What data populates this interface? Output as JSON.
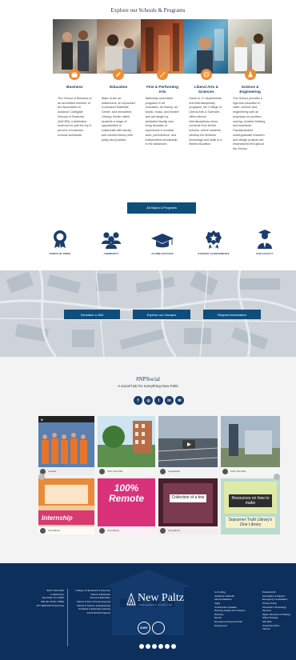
{
  "schools_section": {
    "title": "Explore our Schools & Programs",
    "schools": [
      {
        "icon": "briefcase-icon",
        "title": "Business",
        "desc": "The School of Business is an accredited member of the Association to Advance Collegiate Schools of Business (AACSB), a distinction reserved for just the top 5 percent of business schools worldwide."
      },
      {
        "icon": "pencil-icon",
        "title": "Education",
        "desc": "State-of-the art classrooms, an expanded Curriculum Materials Center, and remodeled Literacy Center offers students a range of opportunities to collaborate with faculty and connect theory with policy and practice."
      },
      {
        "icon": "paintbrush-icon",
        "title": "Fine & Performing Arts",
        "desc": "Nationally accredited programs in art education, art history, art studio, music, and theatre arts are taught by dedicated faculty who bring decades of experience in creative work, performance, and independent scholarship in the classroom."
      },
      {
        "icon": "globe-icon",
        "title": "Liberal Arts & Sciences",
        "desc": "Home to 17 departments and interdisciplinary programs, the College of Liberal Arts & Sciences offers vibrant interdisciplinary minor curricula from all five schools, where students develop the timeless knowledge and skills of a liberal education."
      },
      {
        "icon": "flask-icon",
        "title": "Science & Engineering",
        "desc": "The School provides a rigorous education in math, science and engineering with an emphasis on problem-solving, creative thinking and teamwork. Faculty/student undergraduate research and design projects are emphasized throughout the School."
      }
    ],
    "button": "All Majors & Programs"
  },
  "pride": [
    {
      "icon": "ribbon-icon",
      "label": "POINTS OF PRIDE"
    },
    {
      "icon": "people-icon",
      "label": "COMMUNITY"
    },
    {
      "icon": "graduation-cap-icon",
      "label": "ALUMNI SUCCESS"
    },
    {
      "icon": "star-badge-icon",
      "label": "STUDENT ACHIEVEMENTS"
    },
    {
      "icon": "professor-icon",
      "label": "OUR FACULTY"
    }
  ],
  "map_buttons": [
    "Schedule a Visit",
    "Explore our Campus",
    "Request Information"
  ],
  "social": {
    "hashtag": "#NPSocial",
    "subtitle": "A social hub for everything New Paltz",
    "icons": [
      "facebook-icon",
      "instagram-icon",
      "twitter-icon",
      "linkedin-icon",
      "email-icon"
    ],
    "icon_glyphs": [
      "f",
      "◎",
      "t",
      "in",
      "✉"
    ],
    "tiles": [
      {
        "name": "tile-1",
        "handle": "newpaltz",
        "color": "#3f5c8c"
      },
      {
        "name": "tile-2",
        "handle": "SUNY New Paltz",
        "color": "#6f9a6a"
      },
      {
        "name": "tile-3",
        "handle": "newpaltzweb",
        "color": "#4c5058"
      },
      {
        "name": "tile-4",
        "handle": "SUNY New Paltz",
        "color": "#8fa5b8"
      },
      {
        "name": "tile-5",
        "handle": "sunynplibrary",
        "overlay": "Internship",
        "color": "#f0a65a"
      },
      {
        "name": "tile-6",
        "handle": "sunynplibrary",
        "overlay": "100% Remote",
        "color": "#d9327a"
      },
      {
        "name": "tile-7",
        "handle": "sunynplibrary",
        "overlay": "Collection of a few",
        "color": "#6a2b3f"
      },
      {
        "name": "tile-8",
        "handle": "sunynplibrary",
        "overlay": "Resources on how to make",
        "color": "#9cc7b8"
      }
    ],
    "tile_caption": "Sojourner Truth Library's Zine Library"
  },
  "footer": {
    "address": [
      "SUNY New Paltz",
      "1 Hawk Drive",
      "New Paltz, NY 12561",
      "845-257-SUNY (7869)",
      "877-NEW-PALTZ (toll free)"
    ],
    "schools": [
      "College of Liberal Arts & Sciences",
      "School of Business",
      "School of Education",
      "School of Fine & Performing Arts",
      "School of Science & Engineering",
      "Graduate & Extended Learning",
      "International Programs"
    ],
    "logo_main": "New Paltz",
    "logo_sub": "STATE UNIVERSITY OF NEW YORK",
    "suny": "SUNY",
    "links_1": [
      "A-Z Listing",
      "Academic Calendar",
      "Alumni Relations",
      "Apply",
      "Construction Updates",
      "Diversity, Equity and Inclusion",
      "Directory",
      "Events",
      "Emergency Response Plan",
      "Employment"
    ],
    "links_2": [
      "Financial Aid",
      "Foundation & Support",
      "Emergency Consultation Privacy Policy",
      "Information Technology Services",
      "Maps, Directions & Parking",
      "Office Closings",
      "Site Map",
      "University Police",
      "Visit Us"
    ],
    "social_icons": [
      "facebook-icon",
      "instagram-icon",
      "twitter-icon",
      "youtube-icon",
      "linkedin-icon",
      "email-icon"
    ]
  },
  "colors": {
    "accent": "#f38b2b",
    "navy": "#1a3d6b",
    "button": "#0d4f7a",
    "footer": "#0d2f5c"
  }
}
